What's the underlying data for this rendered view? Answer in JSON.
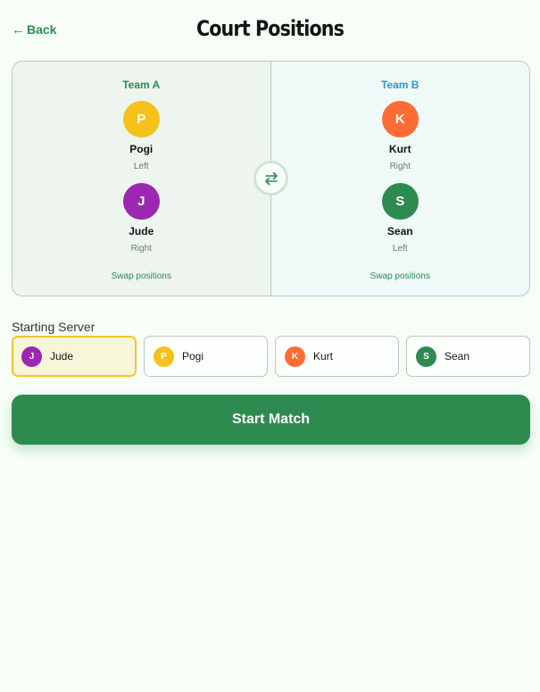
{
  "header": {
    "back_arrow": "←",
    "back_label": "Back",
    "title": "Court Positions"
  },
  "court": {
    "team_a": {
      "label": "Team A",
      "color": "#2e8b50",
      "players": [
        {
          "initial": "P",
          "name": "Pogi",
          "position": "Left",
          "color": "#f5c21b"
        },
        {
          "initial": "J",
          "name": "Jude",
          "position": "Right",
          "color": "#9c27b0"
        }
      ],
      "swap_label": "Swap positions"
    },
    "team_b": {
      "label": "Team B",
      "color": "#2e98cf",
      "players": [
        {
          "initial": "K",
          "name": "Kurt",
          "position": "Right",
          "color": "#ff6b35"
        },
        {
          "initial": "S",
          "name": "Sean",
          "position": "Left",
          "color": "#2e8b50"
        }
      ],
      "swap_label": "Swap positions"
    },
    "swap_icon": "swap-arrows-icon"
  },
  "server": {
    "title": "Starting Server",
    "selected": "Jude",
    "options": [
      {
        "initial": "J",
        "name": "Jude",
        "color": "#9c27b0"
      },
      {
        "initial": "P",
        "name": "Pogi",
        "color": "#f5c21b"
      },
      {
        "initial": "K",
        "name": "Kurt",
        "color": "#ff6b35"
      },
      {
        "initial": "S",
        "name": "Sean",
        "color": "#2e8b50"
      }
    ]
  },
  "start_button": {
    "label": "Start Match",
    "color": "#2e8b50"
  }
}
